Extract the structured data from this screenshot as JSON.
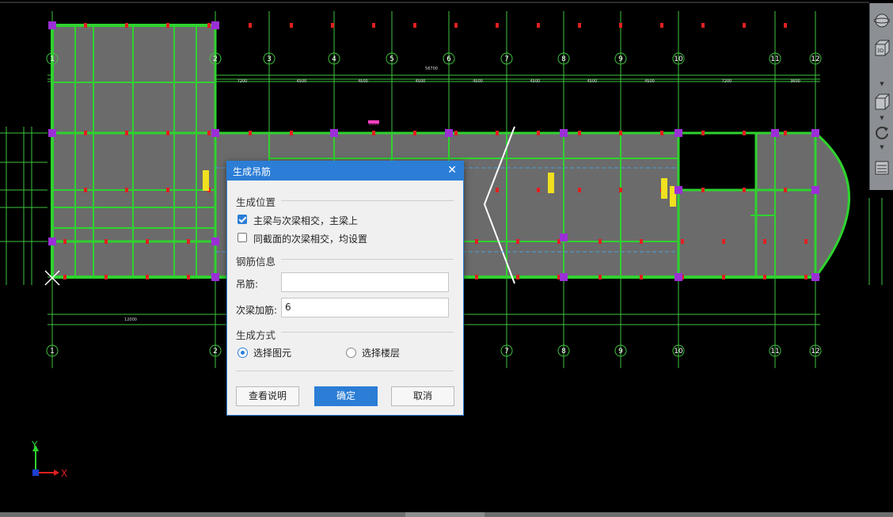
{
  "cad": {
    "top_axes": [
      "1",
      "2",
      "3",
      "4",
      "5",
      "6",
      "7",
      "8",
      "9",
      "10",
      "11",
      "12"
    ],
    "bottom_axes": [
      "1",
      "2",
      "7",
      "8",
      "9",
      "10",
      "11",
      "12"
    ],
    "top_dim_total": "56700",
    "bottom_dim_first": "12000",
    "ucs_x": "X",
    "ucs_y": "Y",
    "pink_mark": "2600",
    "colors": {
      "background": "#000000",
      "grid": "#3ec43e",
      "slab": "#6b6b6b",
      "beam": "#2fd22f",
      "column": "#9b2fd6",
      "rebar_mark": "#e02020",
      "tag": "#f0e020"
    }
  },
  "toolbar": {
    "icons": [
      "globe-icon",
      "view-3d-icon",
      "cube-view-icon",
      "rotate-icon",
      "layers-icon"
    ],
    "view_3d_label": "3D"
  },
  "dialog": {
    "title": "生成吊筋",
    "section_position": "生成位置",
    "option_main_secondary": "主梁与次梁相交，主梁上",
    "option_main_secondary_checked": true,
    "option_same_section": "同截面的次梁相交，均设置",
    "option_same_section_checked": false,
    "section_rebar": "钢筋信息",
    "hanger_label": "吊筋:",
    "hanger_value": "",
    "secondary_add_label": "次梁加筋:",
    "secondary_add_value": "6",
    "section_method": "生成方式",
    "method_select_element": "选择图元",
    "method_select_floor": "选择楼层",
    "method_selected": "选择图元",
    "btn_help": "查看说明",
    "btn_ok": "确定",
    "btn_cancel": "取消"
  }
}
